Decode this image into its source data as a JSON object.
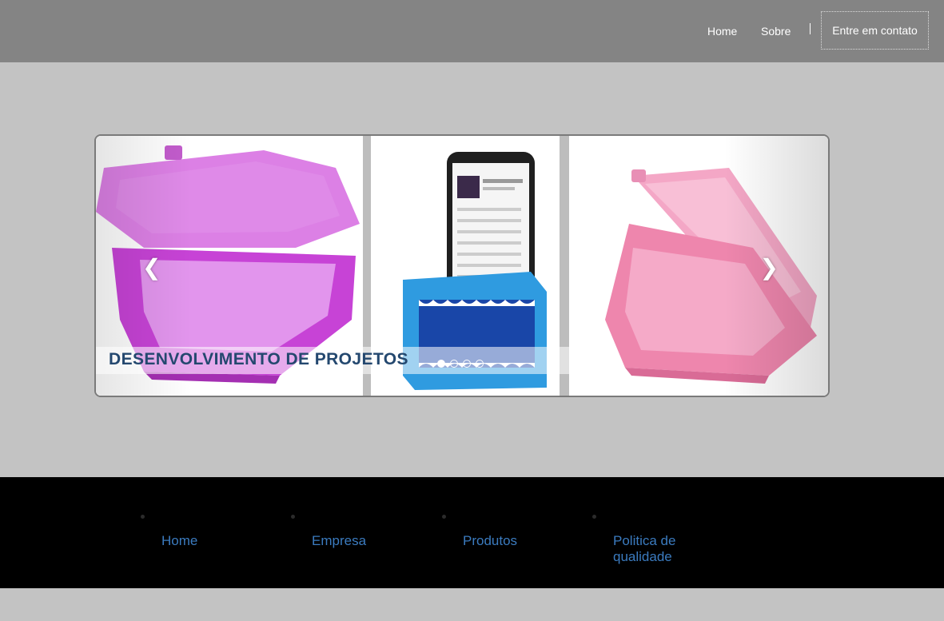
{
  "header": {
    "nav": {
      "home": "Home",
      "sobre": "Sobre",
      "contact": "Entre em contato"
    }
  },
  "carousel": {
    "caption": "DESENVOLVIMENTO DE PROJETOS",
    "prev_icon": "chevron-left-icon",
    "next_icon": "chevron-right-icon",
    "slide_count": 4,
    "active_slide": 1
  },
  "footer": {
    "links": [
      "Home",
      "Empresa",
      "Produtos",
      "Politica de qualidade"
    ]
  },
  "colors": {
    "header_bg": "#848484",
    "page_bg": "#c3c3c3",
    "footer_bg": "#000000",
    "footer_link": "#3b7bbf",
    "caption_text": "#24486f"
  }
}
